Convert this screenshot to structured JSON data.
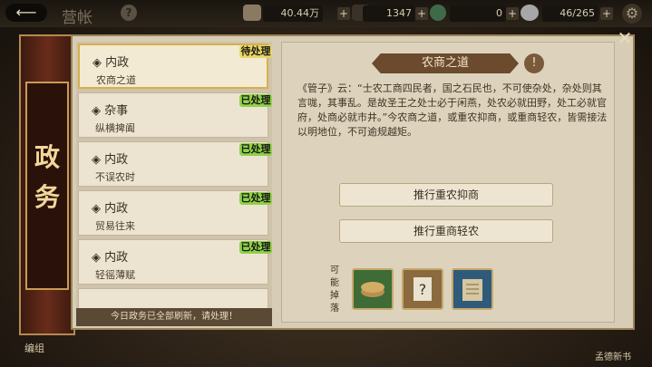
{
  "topbar": {
    "back_icon": "back-arrow-icon",
    "title": "营帐",
    "help": "?",
    "res1": {
      "value": "40.44万",
      "icon": "silver-icon",
      "plus": "+"
    },
    "res2": {
      "value": "1347",
      "icon": "jade-icon",
      "plus": "+"
    },
    "res3": {
      "value": "0",
      "icon": "coin-icon",
      "plus": "+"
    },
    "res4": {
      "value": "46/265",
      "icon": "stamina-icon",
      "plus": "+"
    },
    "settings_icon": "gear-icon"
  },
  "banner": {
    "title": "政务"
  },
  "list": {
    "items": [
      {
        "category": "◈ 内政",
        "name": "农商之道",
        "badge": "待处理",
        "badge_color": "#e8d66a"
      },
      {
        "category": "◈ 杂事",
        "name": "纵横捭阖",
        "badge": "已处理",
        "badge_color": "#8fd14a"
      },
      {
        "category": "◈ 内政",
        "name": "不误农时",
        "badge": "已处理",
        "badge_color": "#8fd14a"
      },
      {
        "category": "◈ 内政",
        "name": "贸易往来",
        "badge": "已处理",
        "badge_color": "#8fd14a"
      },
      {
        "category": "◈ 内政",
        "name": "轻徭薄赋",
        "badge": "已处理",
        "badge_color": "#8fd14a"
      }
    ],
    "footer": "今日政务已全部刷新，请处理！"
  },
  "detail": {
    "title": "农商之道",
    "info_icon": "!",
    "text": "《管子》云：“士农工商四民者，国之石民也，不可使杂处，杂处则其言哤，其事乱。是故圣王之处士必于闲燕，处农必就田野，处工必就官府，处商必就市井。”今农商之道，或重农抑商，或重商轻农，皆需接法以明地位，不可逾规越矩。",
    "option1": "推行重农抑商",
    "option2": "推行重商轻农",
    "drop_label": "可能掉落"
  },
  "bottom": {
    "left": "编组",
    "right": "孟德新书"
  },
  "close": "✕"
}
